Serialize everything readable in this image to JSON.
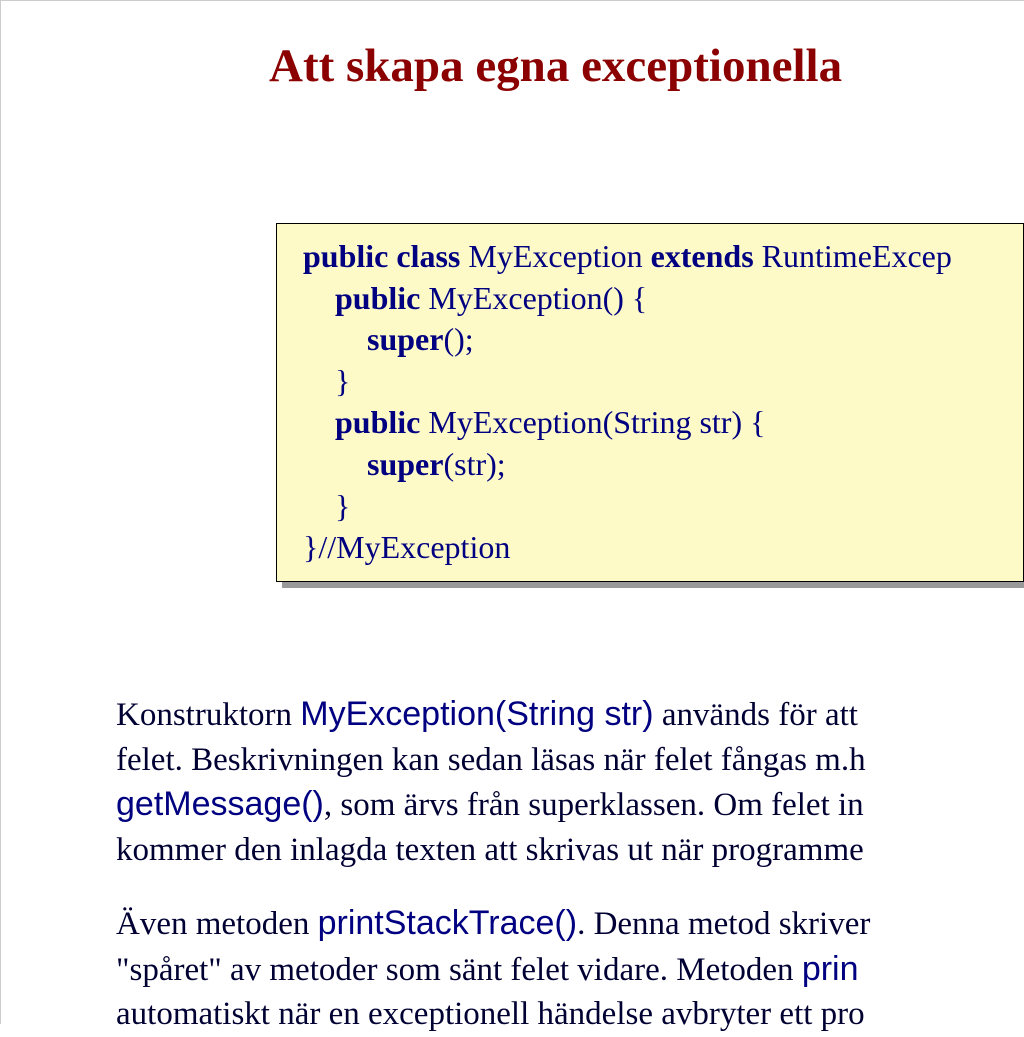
{
  "title": "Att skapa egna exceptionella ",
  "code": {
    "l1a": "public class",
    "l1b": " MyException ",
    "l1c": "extends",
    "l1d": " RuntimeExcep",
    "l2a": "    public",
    "l2b": " MyException() {",
    "l3a": "        super",
    "l3b": "();",
    "l4": "    }",
    "l5a": "    public",
    "l5b": " MyException(String str) {",
    "l6a": "        super",
    "l6b": "(str);",
    "l7": "    }",
    "l8": "}//MyException"
  },
  "para1": {
    "t1": "Konstruktorn ",
    "m1": "MyException(String str)",
    "t2": " används för att ",
    "t3": "felet. Beskrivningen kan sedan läsas när felet fångas m.h",
    "m2": "getMessage()",
    "t4": ", som ärvs från superklassen. Om felet in",
    "t5": "kommer den inlagda texten att skrivas ut när programme"
  },
  "para2": {
    "t1": "Även metoden ",
    "m1": "printStackTrace()",
    "t2": ". Denna metod skriver",
    "t3": "\"spåret\" av metoder som sänt felet vidare. Metoden ",
    "m2": "prin",
    "t4": "automatiskt när en exceptionell händelse avbryter ett pro"
  }
}
